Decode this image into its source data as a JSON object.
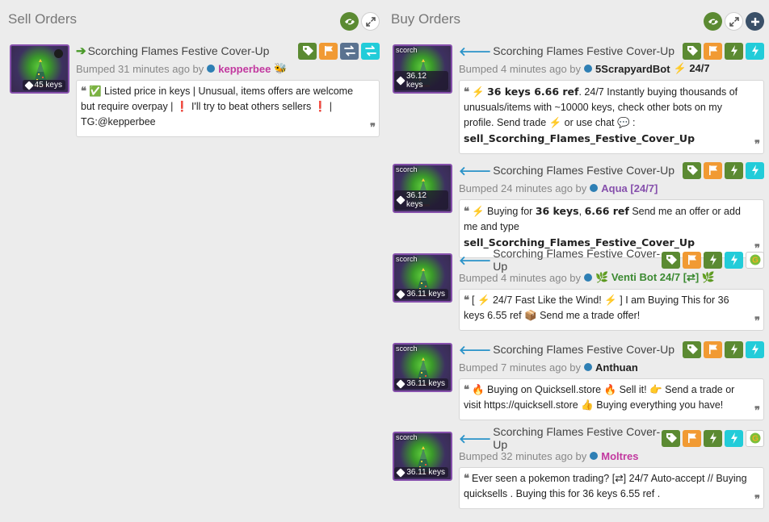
{
  "sell": {
    "title": "Sell Orders",
    "listings": [
      {
        "item_name": "Scorching Flames Festive Cover-Up",
        "price_badge": "45 keys",
        "bumped_prefix": "Bumped 31 minutes ago by",
        "username": "kepperbee",
        "user_emoji": "🐝",
        "desc_parts": [
          "✅ Listed price in keys | Unusual, items offers are welcome but require overpay | ",
          "❗",
          " I'll try to beat others sellers ",
          "❗",
          " | TG:@kepperbee"
        ]
      }
    ]
  },
  "buy": {
    "title": "Buy Orders",
    "listings": [
      {
        "item_name": "Scorching Flames Festive Cover-Up",
        "alias": "scorch",
        "price_badge": "36.12 keys",
        "bumped_prefix": "Bumped 4 minutes ago by",
        "username": "5ScrapyardBot",
        "user_extra": "⚡ 24/7",
        "desc_a": "⚡",
        "desc_b": "36 keys 6.66 ref",
        "desc_c": ". 24/7 Instantly buying thousands of unusuals/items with ~10000 keys, check other bots on my profile. Send  trade ⚡ or  use  chat 💬 :",
        "desc_d": "sell_Scorching_Flames_Festive_Cover_Up"
      },
      {
        "item_name": "Scorching Flames Festive Cover-Up",
        "alias": "scorch",
        "price_badge": "36.12 keys",
        "bumped_prefix": "Bumped 24 minutes ago by",
        "username": "Aqua [24/7]",
        "desc_a": "⚡",
        "desc_b": " Buying for ",
        "desc_c": "36 keys",
        "desc_d": ", ",
        "desc_e": "6.66 ref",
        "desc_f": " Send me an offer or add me and type ",
        "desc_g": "sell_Scorching_Flames_Festive_Cover_Up"
      },
      {
        "item_name": "Scorching Flames Festive Cover-Up",
        "alias": "scorch",
        "price_badge": "36.11 keys",
        "bumped_prefix": "Bumped 4 minutes ago by",
        "username": "🌿 Venti Bot 24/7 [⇄] 🌿",
        "desc": "[ ⚡ 24/7 Fast Like the Wind! ⚡ ] I am Buying This for 36 keys 6.55 ref 📦 Send me a trade offer!"
      },
      {
        "item_name": "Scorching Flames Festive Cover-Up",
        "alias": "scorch",
        "price_badge": "36.11 keys",
        "bumped_prefix": "Bumped 7 minutes ago by",
        "username": "Anthuan",
        "desc": "🔥 Buying on Quicksell.store 🔥  Sell it!  👉  Send a trade or visit https://quicksell.store  👍  Buying everything you have!"
      },
      {
        "item_name": "Scorching Flames Festive Cover-Up",
        "alias": "scorch",
        "price_badge": "36.11 keys",
        "bumped_prefix": "Bumped 32 minutes ago by",
        "username": "Moltres",
        "desc": "Ever seen a pokemon trading? [⇄] 24/7 Auto-accept // Buying quicksells . Buying this for 36 keys 6.55 ref ."
      }
    ]
  },
  "colors": {
    "green": "#5b8a32",
    "orange": "#f19a33",
    "slate": "#5a7290",
    "cyan": "#22ccd9",
    "unusual_purple": "#8650ac",
    "user_pink": "#c2389f"
  },
  "icons": [
    "eye-icon",
    "expand-icon",
    "plus-icon",
    "tag-icon",
    "flag-icon",
    "swap-icon",
    "bolt-icon",
    "gold-g-icon",
    "quote-icon"
  ]
}
